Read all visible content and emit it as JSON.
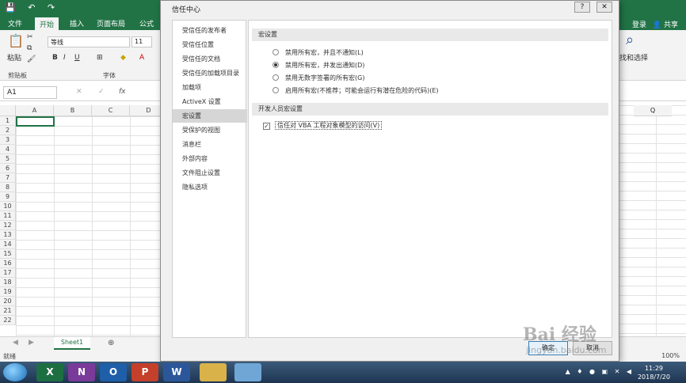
{
  "excel": {
    "tabs": [
      "文件",
      "开始",
      "插入",
      "页面布局",
      "公式"
    ],
    "active_tab": "开始",
    "login": "登录",
    "share": "共享",
    "ribbon": {
      "paste": "粘贴",
      "clipboard_group": "剪贴板",
      "font_group": "字体",
      "font_name": "等线",
      "font_size": "11",
      "bold": "B",
      "italic": "I",
      "underline": "U",
      "find_select": "找和选择"
    },
    "name_box": "A1",
    "fx": "fx",
    "columns": [
      "A",
      "B",
      "C",
      "D"
    ],
    "column_q": "Q",
    "rows": [
      "1",
      "2",
      "3",
      "4",
      "5",
      "6",
      "7",
      "8",
      "9",
      "10",
      "11",
      "12",
      "13",
      "14",
      "15",
      "16",
      "17",
      "18",
      "19",
      "20",
      "21",
      "22"
    ],
    "sheet_tab": "Sheet1",
    "status": "就绪",
    "zoom": "100%"
  },
  "dialog": {
    "title": "信任中心",
    "help": "?",
    "close": "✕",
    "nav": [
      "受信任的发布者",
      "受信任位置",
      "受信任的文档",
      "受信任的加载项目录",
      "加载项",
      "ActiveX 设置",
      "宏设置",
      "受保护的视图",
      "消息栏",
      "外部内容",
      "文件阻止设置",
      "隐私选项"
    ],
    "selected_nav": "宏设置",
    "macro_section": "宏设置",
    "macro_options": [
      "禁用所有宏，并且不通知(L)",
      "禁用所有宏，并发出通知(D)",
      "禁用无数字签署的所有宏(G)",
      "启用所有宏(不推荐；可能会运行有潜在危险的代码)(E)"
    ],
    "macro_selected": 1,
    "dev_section": "开发人员宏设置",
    "vba_trust": "信任对 VBA 工程对象模型的访问(V)",
    "vba_checked": true,
    "ok": "确定",
    "cancel": "取消"
  },
  "taskbar": {
    "apps": [
      "X",
      "N",
      "O",
      "P",
      "W",
      "",
      ""
    ],
    "time": "11:29",
    "date": "2018/7/20"
  },
  "watermark": {
    "brand": "Bai 经验",
    "url": "jingyan.baidu.com"
  }
}
